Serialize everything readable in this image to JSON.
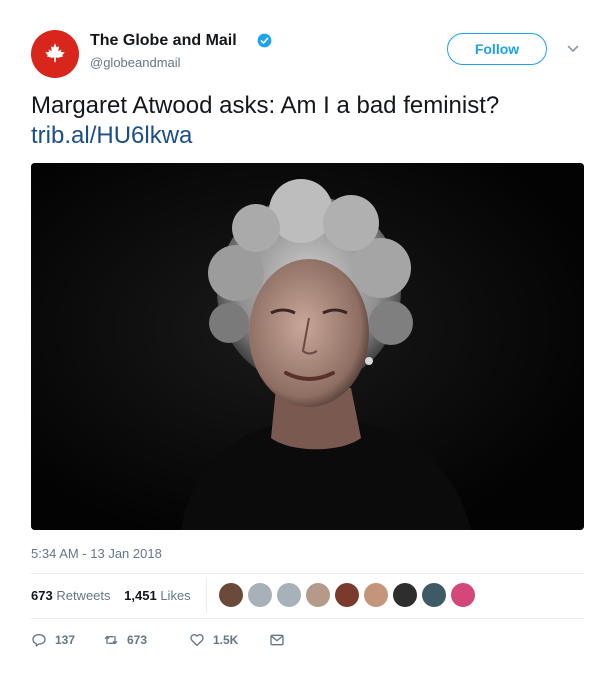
{
  "author": {
    "display_name": "The Globe and Mail",
    "handle": "@globeandmail",
    "verified": true,
    "avatar_icon": "maple-leaf-icon",
    "brand_color": "#d9261c"
  },
  "header": {
    "follow_label": "Follow",
    "menu_icon": "chevron-down-icon"
  },
  "tweet": {
    "text": "Margaret Atwood asks: Am I a bad feminist?",
    "link": "trib.al/HU6lkwa",
    "link_color": "#1b4f8a",
    "timestamp": "5:34 AM - 13 Jan 2018"
  },
  "stats": {
    "retweets_count": "673",
    "retweets_label": "Retweets",
    "likes_count": "1,451",
    "likes_label": "Likes",
    "liker_avatars": 9
  },
  "actions": {
    "reply_count": "137",
    "retweet_count": "673",
    "like_count": "1.5K"
  },
  "colors": {
    "accent": "#1da1f2",
    "secondary_text": "#657786",
    "divider": "#e6ecf0"
  }
}
